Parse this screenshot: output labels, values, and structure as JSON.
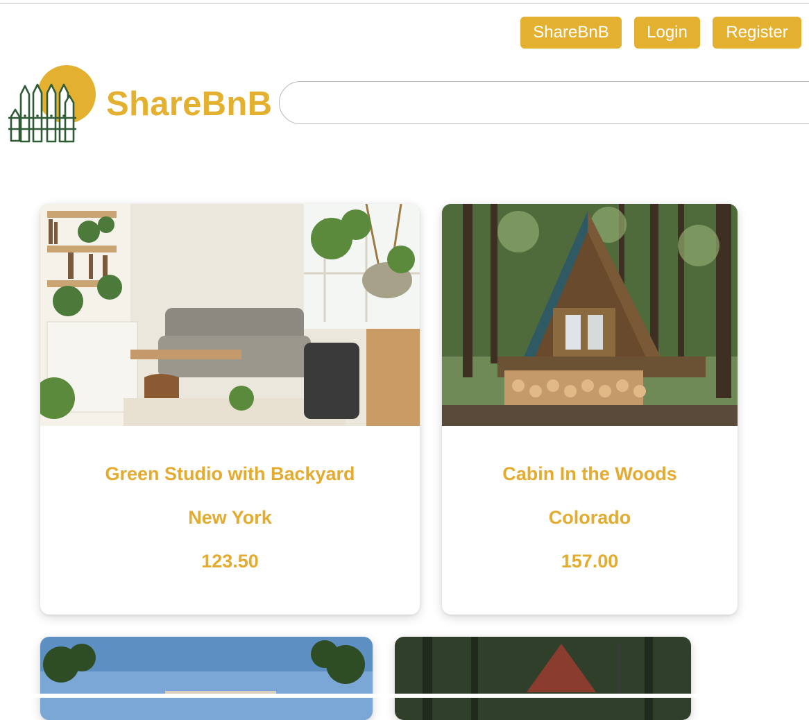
{
  "nav": {
    "sharebnb_label": "ShareBnB",
    "login_label": "Login",
    "register_label": "Register"
  },
  "brand": {
    "name": "ShareBnB",
    "logo_icon": "fence-sun-icon"
  },
  "search": {
    "value": "",
    "placeholder": ""
  },
  "colors": {
    "accent": "#e3b030",
    "logo_fence": "#2e5a35"
  },
  "listings": [
    {
      "title": "Green Studio with Backyard",
      "location": "New York",
      "price": "123.50",
      "photo": "living-room-photo"
    },
    {
      "title": "Cabin In the Woods",
      "location": "Colorado",
      "price": "157.00",
      "photo": "a-frame-cabin-photo"
    },
    {
      "photo": "tropical-house-photo"
    },
    {
      "photo": "forest-cabin-photo"
    }
  ]
}
